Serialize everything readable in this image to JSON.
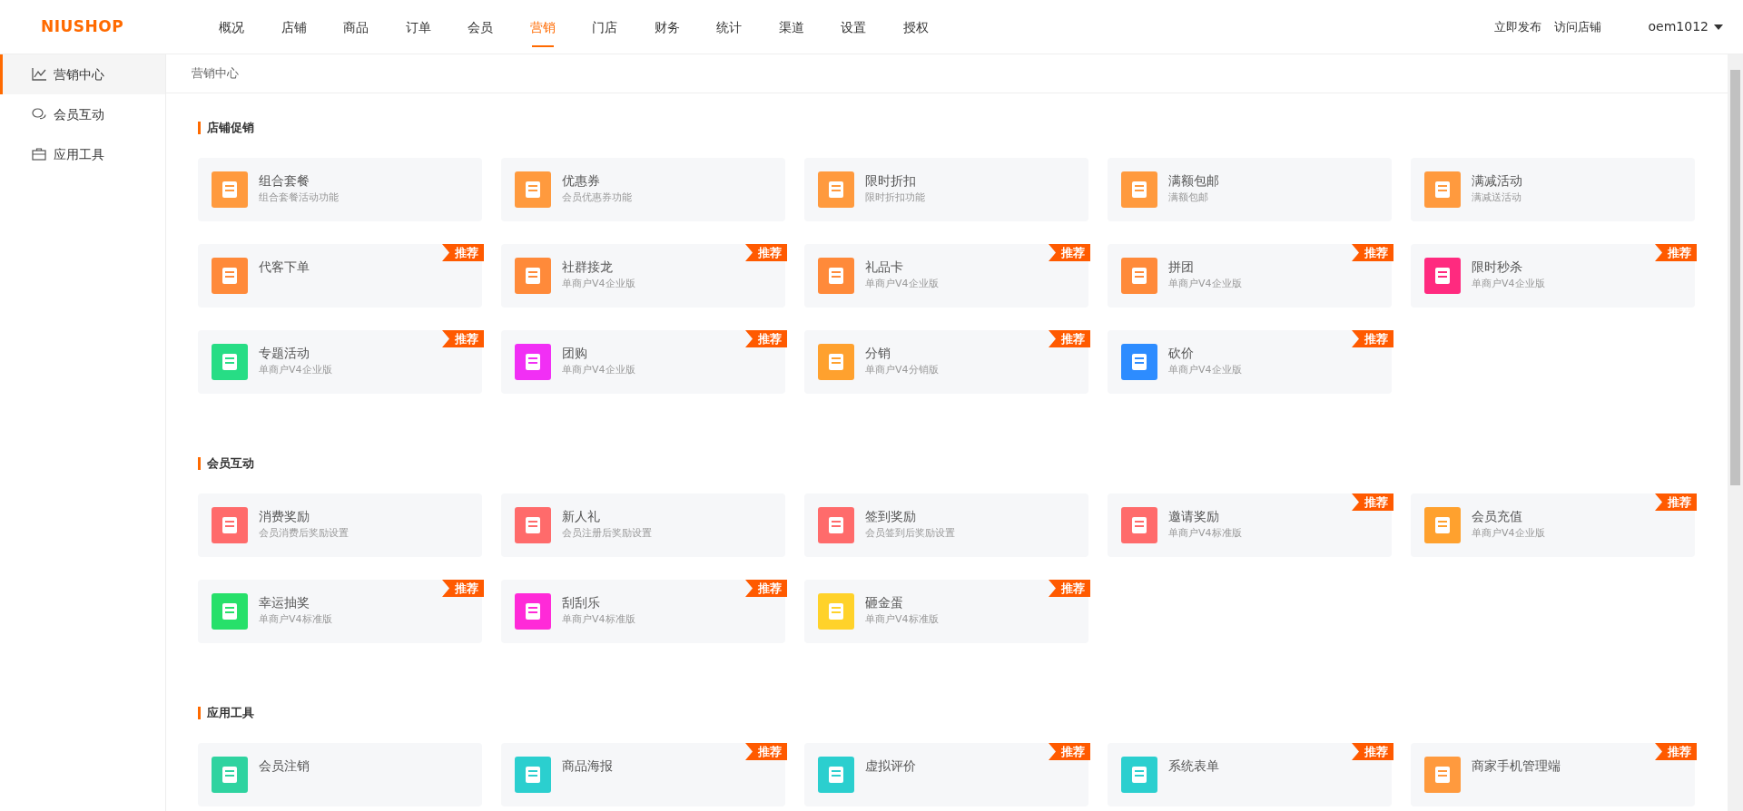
{
  "logo": "NIUSHOP",
  "nav": [
    {
      "label": "概况",
      "selected": false
    },
    {
      "label": "店铺",
      "selected": false
    },
    {
      "label": "商品",
      "selected": false
    },
    {
      "label": "订单",
      "selected": false
    },
    {
      "label": "会员",
      "selected": false
    },
    {
      "label": "营销",
      "selected": true
    },
    {
      "label": "门店",
      "selected": false
    },
    {
      "label": "财务",
      "selected": false
    },
    {
      "label": "统计",
      "selected": false
    },
    {
      "label": "渠道",
      "selected": false
    },
    {
      "label": "设置",
      "selected": false
    },
    {
      "label": "授权",
      "selected": false
    }
  ],
  "header_links": [
    "立即发布",
    "访问店铺"
  ],
  "user": "oem1012",
  "sidebar": {
    "items": [
      {
        "label": "营销中心",
        "selected": true
      },
      {
        "label": "会员互动",
        "selected": false
      },
      {
        "label": "应用工具",
        "selected": false
      }
    ]
  },
  "breadcrumb": "营销中心",
  "sections": [
    {
      "title": "店铺促销",
      "cards": [
        {
          "title": "组合套餐",
          "desc": "组合套餐活动功能",
          "color": "#ff9a3e"
        },
        {
          "title": "优惠券",
          "desc": "会员优惠券功能",
          "color": "#ff9a3e"
        },
        {
          "title": "限时折扣",
          "desc": "限时折扣功能",
          "color": "#ff9a3e"
        },
        {
          "title": "满额包邮",
          "desc": "满额包邮",
          "color": "#ff9a3e"
        },
        {
          "title": "满减活动",
          "desc": "满减送活动",
          "color": "#ff9a3e"
        },
        {
          "title": "代客下单",
          "color": "#ff8a3a",
          "badge": "推荐"
        },
        {
          "title": "社群接龙",
          "desc": "单商户V4企业版",
          "color": "#ff8a3a",
          "badge": "推荐"
        },
        {
          "title": "礼品卡",
          "desc": "单商户V4企业版",
          "color": "#ff8a3a",
          "badge": "推荐"
        },
        {
          "title": "拼团",
          "desc": "单商户V4企业版",
          "color": "#ff8a3a",
          "badge": "推荐"
        },
        {
          "title": "限时秒杀",
          "desc": "单商户V4企业版",
          "color": "#ff2a7f",
          "badge": "推荐"
        },
        {
          "title": "专题活动",
          "desc": "单商户V4企业版",
          "color": "#27dd85",
          "badge": "推荐"
        },
        {
          "title": "团购",
          "desc": "单商户V4企业版",
          "color": "#f12ff5",
          "badge": "推荐"
        },
        {
          "title": "分销",
          "desc": "单商户V4分销版",
          "color": "#ffa12e",
          "badge": "推荐"
        },
        {
          "title": "砍价",
          "desc": "单商户V4企业版",
          "color": "#2d8cff",
          "badge": "推荐"
        }
      ]
    },
    {
      "title": "会员互动",
      "cards": [
        {
          "title": "消费奖励",
          "desc": "会员消费后奖励设置",
          "color": "#ff6b6b"
        },
        {
          "title": "新人礼",
          "desc": "会员注册后奖励设置",
          "color": "#ff6b6b"
        },
        {
          "title": "签到奖励",
          "desc": "会员签到后奖励设置",
          "color": "#ff6b6b"
        },
        {
          "title": "邀请奖励",
          "desc": "单商户V4标准版",
          "color": "#ff6b6b",
          "badge": "推荐"
        },
        {
          "title": "会员充值",
          "desc": "单商户V4企业版",
          "color": "#ffa12e",
          "badge": "推荐"
        },
        {
          "title": "幸运抽奖",
          "desc": "单商户V4标准版",
          "color": "#27e06a",
          "badge": "推荐"
        },
        {
          "title": "刮刮乐",
          "desc": "单商户V4标准版",
          "color": "#ff2ad8",
          "badge": "推荐"
        },
        {
          "title": "砸金蛋",
          "desc": "单商户V4标准版",
          "color": "#ffd22a",
          "badge": "推荐"
        }
      ]
    },
    {
      "title": "应用工具",
      "cards": [
        {
          "title": "会员注销",
          "color": "#2fd3a0"
        },
        {
          "title": "商品海报",
          "color": "#2bcfcf",
          "badge": "推荐"
        },
        {
          "title": "虚拟评价",
          "color": "#2bcfcf",
          "badge": "推荐"
        },
        {
          "title": "系统表单",
          "color": "#2bcfcf",
          "badge": "推荐"
        },
        {
          "title": "商家手机管理端",
          "color": "#ff9a3e",
          "badge": "推荐"
        }
      ]
    }
  ]
}
